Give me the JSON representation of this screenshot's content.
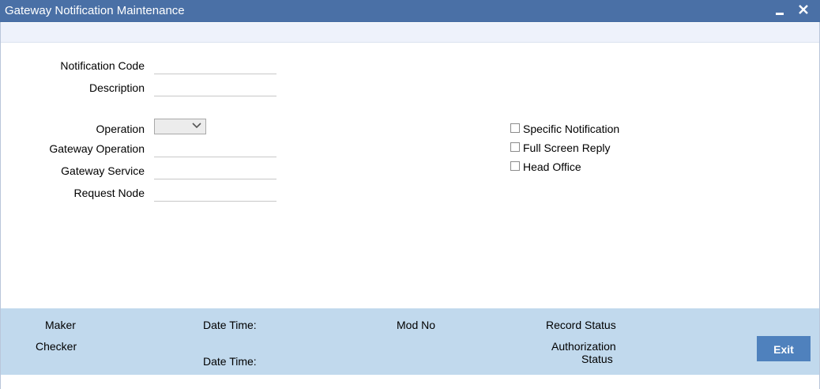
{
  "window": {
    "title": "Gateway Notification Maintenance",
    "minimize_glyph": "▬",
    "close_glyph": "✕"
  },
  "form": {
    "notification_code": {
      "label": "Notification Code",
      "value": ""
    },
    "description": {
      "label": "Description",
      "value": ""
    },
    "operation": {
      "label": "Operation",
      "value": ""
    },
    "gateway_operation": {
      "label": "Gateway Operation",
      "value": ""
    },
    "gateway_service": {
      "label": "Gateway Service",
      "value": ""
    },
    "request_node": {
      "label": "Request Node",
      "value": ""
    }
  },
  "checkboxes": {
    "specific_notification": {
      "label": "Specific Notification",
      "checked": false
    },
    "full_screen_reply": {
      "label": "Full Screen Reply",
      "checked": false
    },
    "head_office": {
      "label": "Head Office",
      "checked": false
    }
  },
  "footer": {
    "maker": "Maker",
    "checker": "Checker",
    "date_time_1": "Date Time:",
    "date_time_2": "Date Time:",
    "mod_no": "Mod No",
    "record_status": "Record Status",
    "authorization": "Authorization",
    "status": "Status",
    "exit_label": "Exit"
  },
  "colors": {
    "titlebar": "#4a70a6",
    "footer": "#c1d9ed",
    "exit_button": "#4f81bd"
  }
}
